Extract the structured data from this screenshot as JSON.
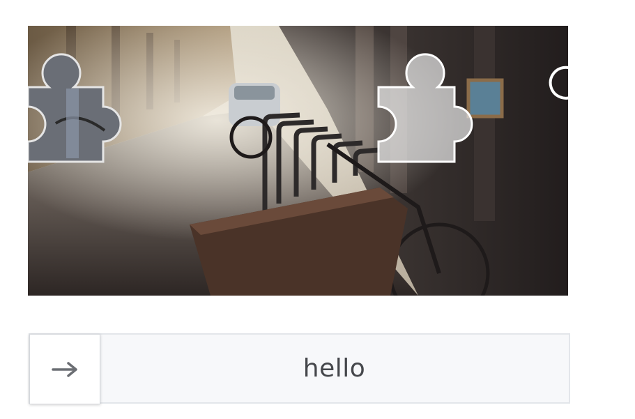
{
  "captcha": {
    "slider": {
      "label": "hello",
      "handle_icon": "arrow-right-icon"
    },
    "refresh": {
      "icon": "refresh-icon"
    },
    "puzzle": {
      "piece_icon": "puzzle-piece",
      "target_icon": "puzzle-slot"
    },
    "colors": {
      "slider_background": "#f7f8fa",
      "slider_border": "#e3e6ea",
      "label_text": "#45474b",
      "arrow": "#6b6e73"
    }
  }
}
